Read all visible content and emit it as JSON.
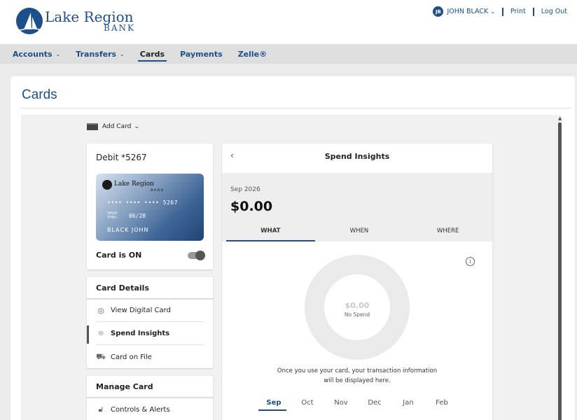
{
  "brand": {
    "name": "Lake Region",
    "sub": "BANK"
  },
  "header": {
    "user_initials": "JB",
    "user_name": "JOHN BLACK",
    "print": "Print",
    "logout": "Log Out"
  },
  "nav": {
    "items": [
      {
        "label": "Accounts",
        "dropdown": true
      },
      {
        "label": "Transfers",
        "dropdown": true
      },
      {
        "label": "Cards",
        "active": true
      },
      {
        "label": "Payments"
      },
      {
        "label": "Zelle®"
      }
    ]
  },
  "page": {
    "title": "Cards"
  },
  "add_card": {
    "label": "Add Card"
  },
  "card": {
    "title": "Debit *5267",
    "brand_name": "Lake Region",
    "brand_sub": "BANK",
    "number": "•••• •••• •••• 5267",
    "valid_label_1": "VALID",
    "valid_label_2": "THRU",
    "expiry": "06/28",
    "holder": "BLACK JOHN",
    "status": "Card is ON",
    "is_on": true
  },
  "card_details": {
    "title": "Card Details",
    "items": [
      {
        "label": "View Digital Card",
        "icon": "eye-icon"
      },
      {
        "label": "Spend Insights",
        "icon": "lightbulb-icon",
        "active": true
      },
      {
        "label": "Card on File",
        "icon": "cart-icon"
      }
    ]
  },
  "manage_card": {
    "title": "Manage Card",
    "items": [
      {
        "label": "Controls & Alerts",
        "icon": "lock-icon"
      }
    ]
  },
  "insights": {
    "title": "Spend Insights",
    "period": "Sep 2026",
    "amount": "$0.00",
    "tabs": [
      {
        "label": "WHAT",
        "active": true
      },
      {
        "label": "WHEN"
      },
      {
        "label": "WHERE"
      }
    ],
    "donut_amount": "$0.00",
    "donut_label": "No Spend",
    "empty_line1": "Once you use your card, your transaction information",
    "empty_line2": "will be displayed here.",
    "months": [
      {
        "label": "Sep",
        "active": true
      },
      {
        "label": "Oct"
      },
      {
        "label": "Nov"
      },
      {
        "label": "Dec"
      },
      {
        "label": "Jan"
      },
      {
        "label": "Feb"
      }
    ]
  },
  "colors": {
    "brand": "#1d4f8a"
  }
}
